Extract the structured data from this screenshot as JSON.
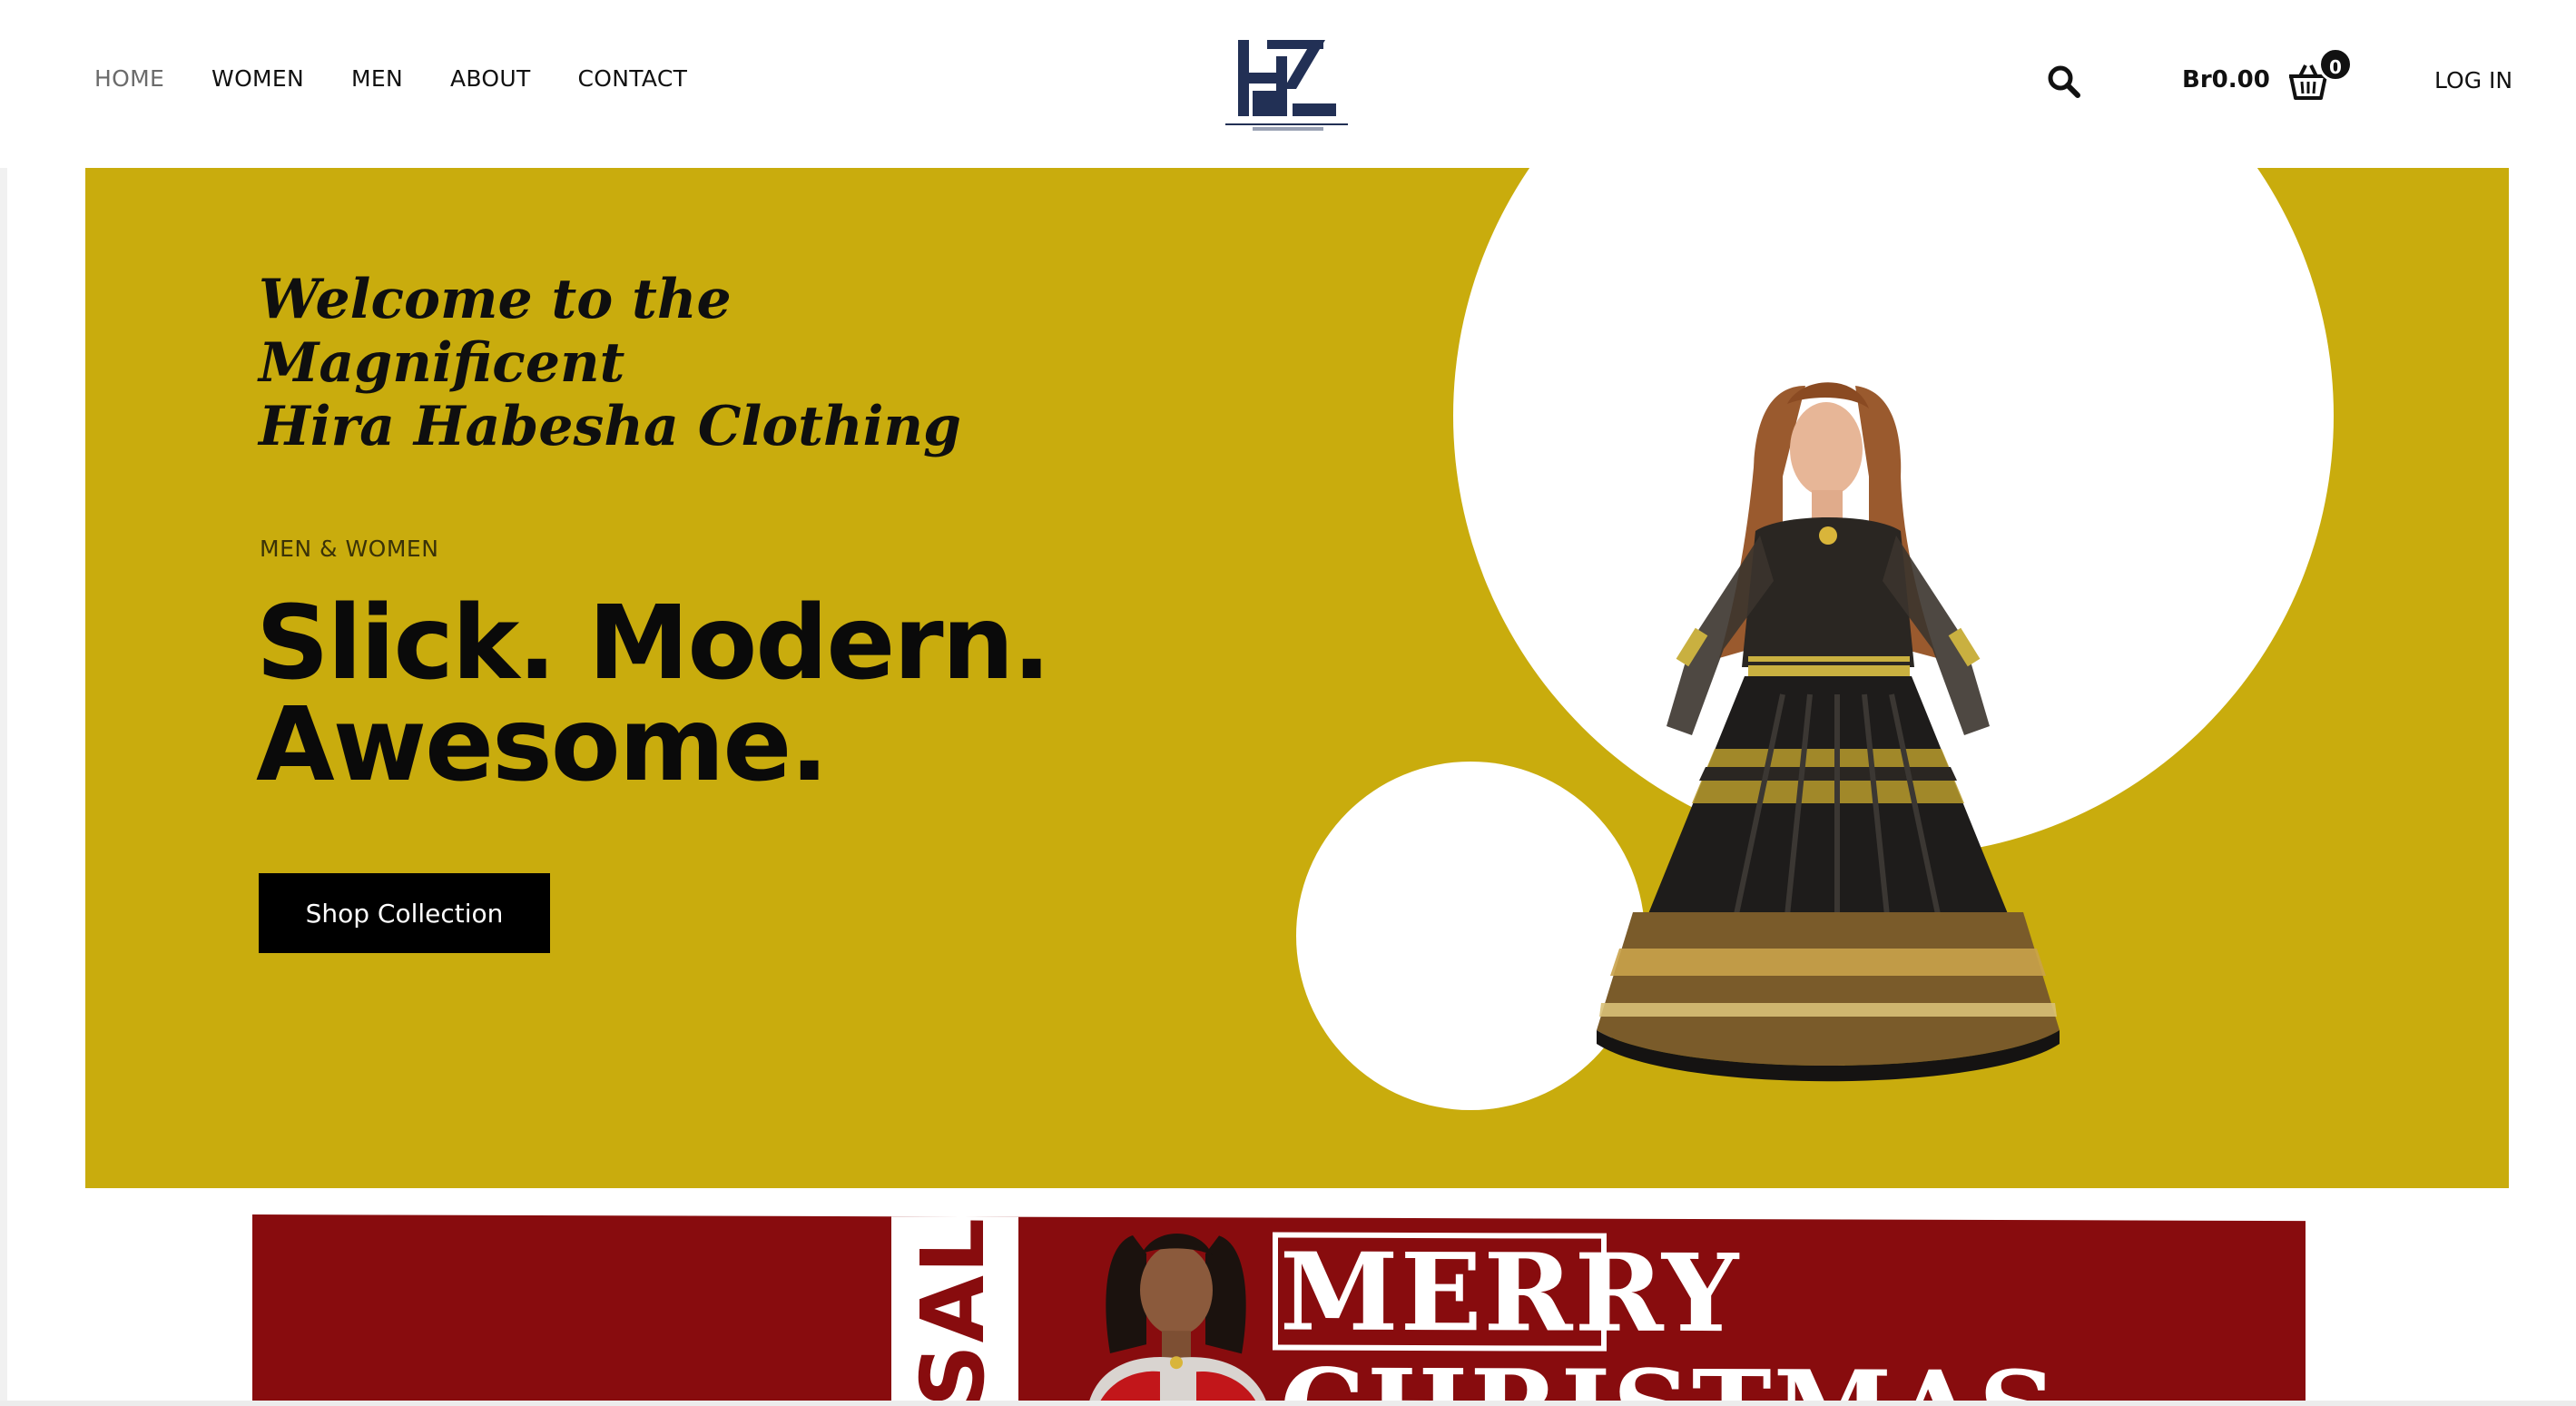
{
  "nav": {
    "items": [
      {
        "label": "HOME",
        "active": true
      },
      {
        "label": "WOMEN",
        "active": false
      },
      {
        "label": "MEN",
        "active": false
      },
      {
        "label": "ABOUT",
        "active": false
      },
      {
        "label": "CONTACT",
        "active": false
      }
    ]
  },
  "header": {
    "logo_icon": "hira-habesha-logo",
    "search_icon": "search-icon",
    "cart_total": "Br0.00",
    "cart_icon": "basket-icon",
    "cart_count": "0",
    "login_label": "LOG IN"
  },
  "hero": {
    "welcome": "Welcome to the\nMagnificent\nHira Habesha Clothing",
    "kicker": "MEN & WOMEN",
    "headline": "Slick. Modern.\nAwesome.",
    "cta_label": "Shop Collection",
    "background_color": "#c9ac0d"
  },
  "promo": {
    "sale_text": "SALE!",
    "merry_text": "MERRY",
    "christmas_text": "CHRISTMAS",
    "background_color": "#880c0e"
  }
}
